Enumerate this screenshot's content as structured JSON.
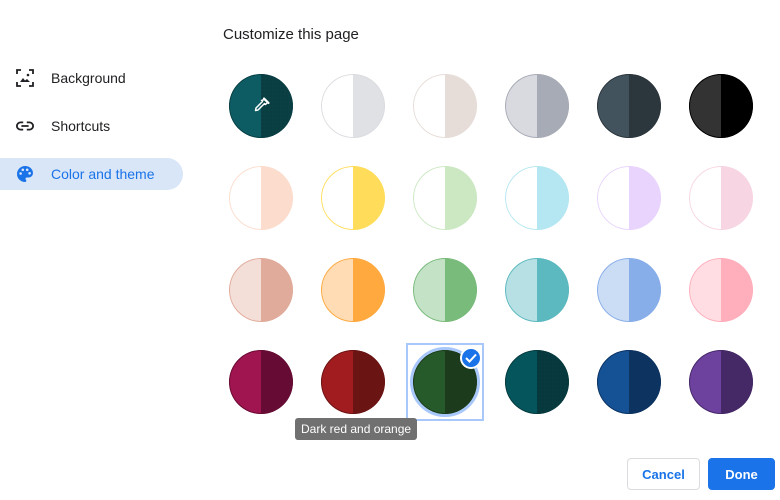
{
  "header": {
    "title": "Customize this page"
  },
  "sidebar": {
    "items": [
      {
        "label": "Background",
        "icon": "image-icon",
        "active": false
      },
      {
        "label": "Shortcuts",
        "icon": "link-icon",
        "active": false
      },
      {
        "label": "Color and theme",
        "icon": "palette-icon",
        "active": true
      }
    ]
  },
  "theme_grid": {
    "columns": 6,
    "selected_index": 20,
    "swatches": [
      {
        "name": "custom-color",
        "left": "#0d5c63",
        "right": "#0a3f44",
        "ring": "#0a3f44",
        "icon": "eyedropper-icon",
        "pattern": true
      },
      {
        "name": "default",
        "left": "#ffffff",
        "right": "#dfe1e5",
        "ring": "#dadce0"
      },
      {
        "name": "warm-grey",
        "left": "#ffffff",
        "right": "#e6dcd8",
        "ring": "#e6dcd8"
      },
      {
        "name": "cool-grey",
        "left": "#d9dae0",
        "right": "#a7abb5",
        "ring": "#a7abb5"
      },
      {
        "name": "midnight-blue",
        "left": "#43535e",
        "right": "#2c363d",
        "ring": "#2c363d"
      },
      {
        "name": "black",
        "left": "#333333",
        "right": "#000000",
        "ring": "#000000"
      },
      {
        "name": "beige-and-white",
        "left": "#ffffff",
        "right": "#fcdccd",
        "ring": "#fcdccd"
      },
      {
        "name": "yellow-and-white",
        "left": "#ffffff",
        "right": "#ffdd5b",
        "ring": "#ffdd5b"
      },
      {
        "name": "green-and-white",
        "left": "#ffffff",
        "right": "#cbe8c3",
        "ring": "#cbe8c3"
      },
      {
        "name": "light-teal-and-white",
        "left": "#ffffff",
        "right": "#b4e7f1",
        "ring": "#b4e7f1"
      },
      {
        "name": "light-purple-and-white",
        "left": "#ffffff",
        "right": "#e8d4fc",
        "ring": "#e8d4fc"
      },
      {
        "name": "pink-and-white",
        "left": "#ffffff",
        "right": "#f7d5e3",
        "ring": "#f7d5e3"
      },
      {
        "name": "beige",
        "left": "#f4ded8",
        "right": "#e1ab9b",
        "ring": "#e1ab9b"
      },
      {
        "name": "orange",
        "left": "#ffdcb3",
        "right": "#ffa93f",
        "ring": "#ffa93f"
      },
      {
        "name": "light-green",
        "left": "#c4e2c6",
        "right": "#78bb7b",
        "ring": "#78bb7b"
      },
      {
        "name": "light-teal",
        "left": "#b6e0e3",
        "right": "#5bb9bf",
        "ring": "#5bb9bf"
      },
      {
        "name": "light-blue",
        "left": "#cbdcf5",
        "right": "#88aee9",
        "ring": "#88aee9"
      },
      {
        "name": "light-pink",
        "left": "#ffdde3",
        "right": "#ffafbc",
        "ring": "#ffafbc"
      },
      {
        "name": "dark-pink-and-red",
        "left": "#a0144f",
        "right": "#660c34",
        "ring": "#660c34"
      },
      {
        "name": "dark-red-and-orange",
        "left": "#a01c1f",
        "right": "#6a1414",
        "ring": "#6a1414"
      },
      {
        "name": "dark-green",
        "left": "#265a2a",
        "right": "#1b3b1c",
        "ring": "#1b3b1c"
      },
      {
        "name": "dark-teal",
        "left": "#05565c",
        "right": "#073a3e",
        "ring": "#073a3e",
        "pattern": true
      },
      {
        "name": "dark-blue",
        "left": "#155195",
        "right": "#0d3361",
        "ring": "#0d3361"
      },
      {
        "name": "purple",
        "left": "#6d419e",
        "right": "#452966",
        "ring": "#452966"
      }
    ]
  },
  "tooltip": {
    "text": "Dark red and orange"
  },
  "actions": {
    "cancel_label": "Cancel",
    "done_label": "Done"
  },
  "colors": {
    "accent": "#1a73e8",
    "active_nav_bg": "#d8e6f8",
    "selection": "#a8c7fa"
  }
}
